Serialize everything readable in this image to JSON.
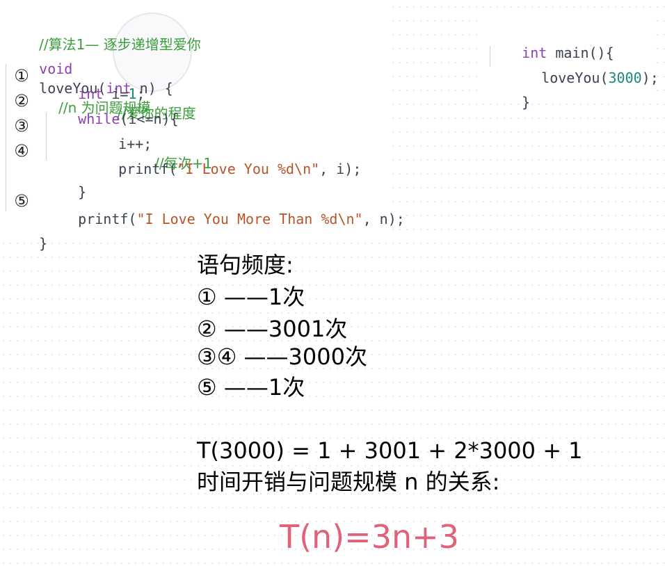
{
  "code": {
    "header_comment": "//算法1— 逐步递增型爱你",
    "signature": {
      "void": "void",
      "fn_open": "loveYou(",
      "int": "int",
      "param": " n) {",
      "comment": "//n 为问题规模"
    },
    "lines": [
      {
        "marker": "①",
        "kw": "int",
        "code": " i=",
        "num": "1",
        "tail": ";",
        "comment": "//爱你的程度"
      },
      {
        "marker": "②",
        "kw": "while",
        "code": "(i<=n){"
      },
      {
        "marker": "③",
        "code": "i++;",
        "comment": "//每次+1"
      },
      {
        "marker": "④",
        "fn": "printf(",
        "str": "\"I Love You %d\\n\"",
        "tail": ", i);"
      },
      {
        "close": "}"
      },
      {
        "marker": "⑤",
        "fn": "printf(",
        "str": "\"I Love You More Than %d\\n\"",
        "tail": ", n);"
      }
    ],
    "closing_brace": "}"
  },
  "main_fn": {
    "int": "int",
    "sig": " main(){",
    "call_name": "loveYou(",
    "call_arg": "3000",
    "call_tail": ");",
    "close": "}"
  },
  "freq": {
    "title": "语句频度:",
    "items": [
      "① ——1次",
      "② ——3001次",
      "③④ ——3000次",
      "⑤ ——1次"
    ]
  },
  "t3000": "T(3000) = 1 + 3001 + 2*3000 + 1",
  "relation": "时间开销与问题规模 n 的关系:",
  "formula": "T(n)=3n+3",
  "colors": {
    "comment": "#3a9e3a",
    "keyword": "#8f3fb0",
    "string": "#b8542a",
    "number": "#1a8a7a",
    "formula": "#e0627a"
  }
}
